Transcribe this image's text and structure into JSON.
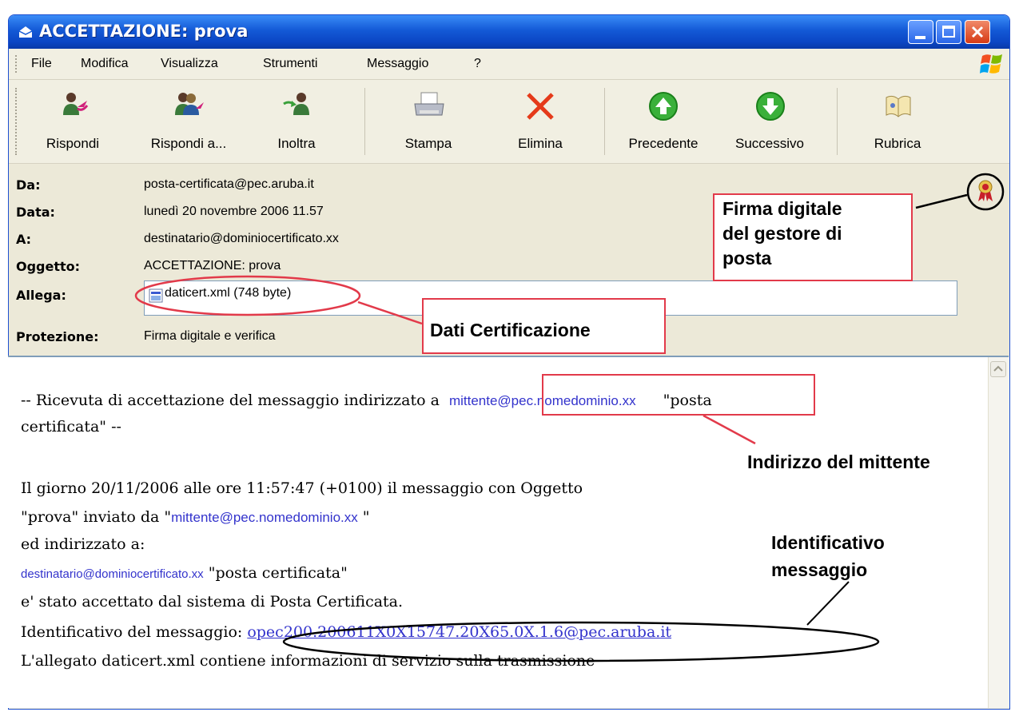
{
  "window": {
    "title": "ACCETTAZIONE: prova",
    "controls": [
      "minimize",
      "maximize",
      "close"
    ]
  },
  "menu": {
    "items": [
      "File",
      "Modifica",
      "Visualizza",
      "Strumenti",
      "Messaggio",
      "?"
    ]
  },
  "toolbar": {
    "buttons": [
      {
        "label": "Rispondi",
        "icon": "reply-icon"
      },
      {
        "label": "Rispondi a...",
        "icon": "reply-all-icon"
      },
      {
        "label": "Inoltra",
        "icon": "forward-icon"
      },
      {
        "label": "Stampa",
        "icon": "printer-icon"
      },
      {
        "label": "Elimina",
        "icon": "delete-icon"
      },
      {
        "label": "Precedente",
        "icon": "previous-icon"
      },
      {
        "label": "Successivo",
        "icon": "next-icon"
      },
      {
        "label": "Rubrica",
        "icon": "address-book-icon"
      }
    ]
  },
  "header": {
    "from_label": "Da:",
    "from_value": "posta-certificata@pec.aruba.it",
    "date_label": "Data:",
    "date_value": "lunedì 20 novembre 2006 11.57",
    "to_label": "A:",
    "to_value": "destinatario@dominiocertificato.xx",
    "subject_label": "Oggetto:",
    "subject_value": "ACCETTAZIONE: prova",
    "attach_label": "Allega:",
    "attach_value": "daticert.xml (748 byte)",
    "protection_label": "Protezione:",
    "protection_value": "Firma digitale e verifica"
  },
  "body": {
    "line1_pre": "-- Ricevuta di accettazione del messaggio indirizzato a ",
    "line1_link": "mittente@pec.nomedominio.xx",
    "line1_post": "\"posta",
    "line2": "certificata\" --",
    "line3": "Il giorno 20/11/2006 alle ore 11:57:47 (+0100) il messaggio con Oggetto",
    "line4_pre": "\"prova\" inviato da \"",
    "line4_link": "mittente@pec.nomedominio.xx",
    "line4_post": " \"",
    "line5": "ed indirizzato a:",
    "line6_link": "destinatario@dominiocertificato.xx",
    "line6_post": " \"posta certificata\"",
    "line7": "e' stato accettato dal sistema di Posta Certificata.",
    "line8_pre": "Identificativo del messaggio: ",
    "line8_link": "opec200.200611X0X15747.20X65.0X.1.6@pec.aruba.it",
    "line9": "L'allegato daticert.xml contiene informazioni di servizio sulla trasmissione"
  },
  "annotations": {
    "firma": [
      "Firma digitale",
      "del gestore di",
      "posta"
    ],
    "dati": "Dati Certificazione",
    "mittente": "Indirizzo del mittente",
    "identificativo": [
      "Identificativo",
      "messaggio"
    ]
  },
  "colors": {
    "link": "#3333cc",
    "annotation_red": "#e23a4a",
    "titlebar": "#1359d6"
  }
}
